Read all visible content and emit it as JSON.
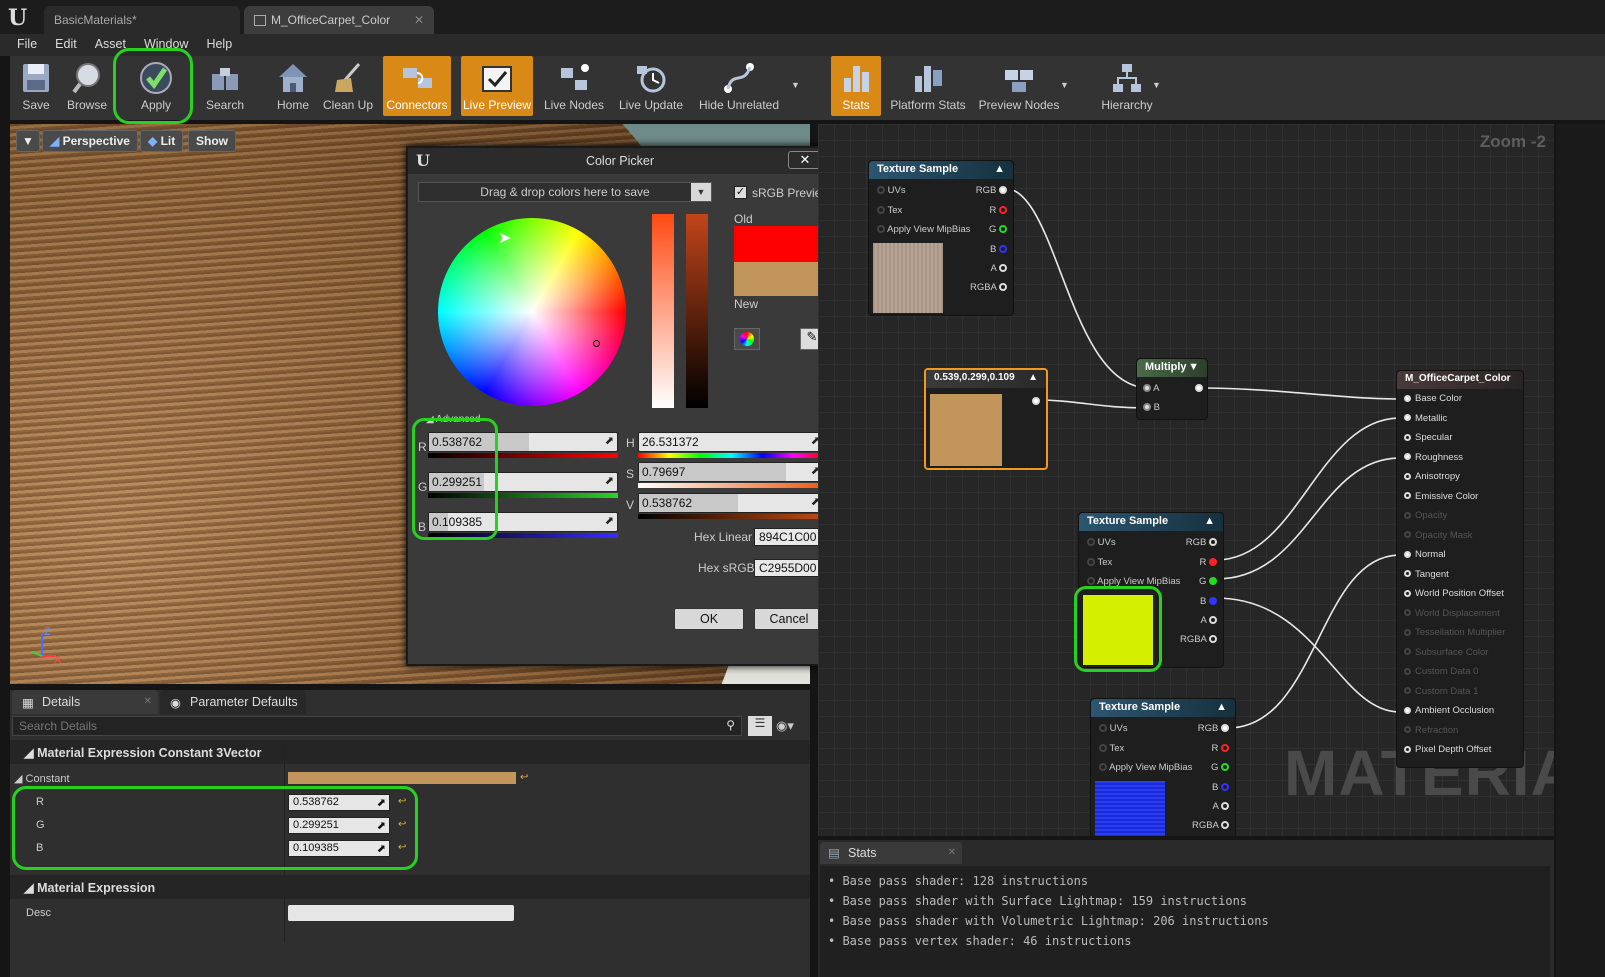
{
  "window": {
    "tabs": [
      {
        "label": "BasicMaterials*"
      },
      {
        "label": "M_OfficeCarpet_Color",
        "close": "✕"
      }
    ]
  },
  "menu": [
    "File",
    "Edit",
    "Asset",
    "Window",
    "Help"
  ],
  "toolbar": {
    "buttons": [
      {
        "label": "Save",
        "icon": "save-icon"
      },
      {
        "label": "Browse",
        "icon": "browse-icon"
      },
      {
        "label": "Apply",
        "icon": "apply-check-icon",
        "highlighted": true
      },
      {
        "label": "Search",
        "icon": "search-icon"
      },
      {
        "label": "Home",
        "icon": "home-icon"
      },
      {
        "label": "Clean Up",
        "icon": "broom-icon"
      },
      {
        "label": "Connectors",
        "icon": "connectors-icon",
        "active": true
      },
      {
        "label": "Live Preview",
        "icon": "live-preview-icon",
        "active": true
      },
      {
        "label": "Live Nodes",
        "icon": "live-nodes-icon"
      },
      {
        "label": "Live Update",
        "icon": "live-update-icon"
      },
      {
        "label": "Hide Unrelated",
        "icon": "hide-unrelated-icon"
      },
      {
        "label": "Stats",
        "icon": "stats-icon",
        "active": true
      },
      {
        "label": "Platform Stats",
        "icon": "platform-stats-icon"
      },
      {
        "label": "Preview Nodes",
        "icon": "preview-nodes-icon"
      },
      {
        "label": "Hierarchy",
        "icon": "hierarchy-icon"
      }
    ]
  },
  "viewport": {
    "perspective": "Perspective",
    "lit": "Lit",
    "show": "Show",
    "axis_z": "Z",
    "axis_x": "X"
  },
  "color_picker": {
    "title": "Color Picker",
    "close": "✕",
    "drop_area": "Drag & drop colors here to save",
    "srgb_preview": "sRGB Preview",
    "old_label": "Old",
    "new_label": "New",
    "old_color": "#ff0000",
    "new_color": "#c2955d",
    "advanced": "Advanced",
    "r_label": "R",
    "r_value": "0.538762",
    "g_label": "G",
    "g_value": "0.299251",
    "b_label": "B",
    "b_value": "0.109385",
    "h_label": "H",
    "h_value": "26.531372",
    "s_label": "S",
    "s_value": "0.79697",
    "v_label": "V",
    "v_value": "0.538762",
    "hex_linear_label": "Hex Linear",
    "hex_linear": "894C1C00",
    "hex_srgb_label": "Hex sRGB",
    "hex_srgb": "C2955D00",
    "ok": "OK",
    "cancel": "Cancel"
  },
  "graph": {
    "zoom": "Zoom -2",
    "watermark": "MATERIAL",
    "tex1": {
      "title": "Texture Sample",
      "pins_in": [
        "UVs",
        "Tex",
        "Apply View MipBias"
      ],
      "pins_out": [
        "RGB",
        "R",
        "G",
        "B",
        "A",
        "RGBA"
      ]
    },
    "constant": {
      "title": "0.539,0.299,0.109",
      "color": "#c2955d"
    },
    "multiply": {
      "title": "Multiply",
      "a": "A",
      "b": "B"
    },
    "tex2": {
      "title": "Texture Sample",
      "pins_in": [
        "UVs",
        "Tex",
        "Apply View MipBias"
      ],
      "pins_out": [
        "RGB",
        "R",
        "G",
        "B",
        "A",
        "RGBA"
      ],
      "swatch": "#d4f000"
    },
    "tex3": {
      "title": "Texture Sample",
      "pins_in": [
        "UVs",
        "Tex",
        "Apply View MipBias"
      ],
      "pins_out": [
        "RGB",
        "R",
        "G",
        "B",
        "A",
        "RGBA"
      ]
    },
    "result": {
      "title": "M_OfficeCarpet_Color",
      "pins": [
        {
          "label": "Base Color",
          "on": true
        },
        {
          "label": "Metallic",
          "on": true
        },
        {
          "label": "Specular",
          "on": true
        },
        {
          "label": "Roughness",
          "on": true
        },
        {
          "label": "Anisotropy",
          "on": true
        },
        {
          "label": "Emissive Color",
          "on": true
        },
        {
          "label": "Opacity",
          "on": false
        },
        {
          "label": "Opacity Mask",
          "on": false
        },
        {
          "label": "Normal",
          "on": true
        },
        {
          "label": "Tangent",
          "on": true
        },
        {
          "label": "World Position Offset",
          "on": true
        },
        {
          "label": "World Displacement",
          "on": false
        },
        {
          "label": "Tessellation Multiplier",
          "on": false
        },
        {
          "label": "Subsurface Color",
          "on": false
        },
        {
          "label": "Custom Data 0",
          "on": false
        },
        {
          "label": "Custom Data 1",
          "on": false
        },
        {
          "label": "Ambient Occlusion",
          "on": true
        },
        {
          "label": "Refraction",
          "on": false
        },
        {
          "label": "Pixel Depth Offset",
          "on": true
        }
      ]
    }
  },
  "details": {
    "tab_details": "Details",
    "tab_params": "Parameter Defaults",
    "search_placeholder": "Search Details",
    "section1": "Material Expression Constant 3Vector",
    "constant_label": "Constant",
    "constant_color": "#c2955d",
    "r_label": "R",
    "r": "0.538762",
    "g_label": "G",
    "g": "0.299251",
    "b_label": "B",
    "b": "0.109385",
    "section2": "Material Expression",
    "desc_label": "Desc"
  },
  "stats": {
    "tab": "Stats",
    "lines": [
      "Base pass shader: 128 instructions",
      "Base pass shader with Surface Lightmap: 159 instructions",
      "Base pass shader with Volumetric Lightmap: 206 instructions",
      "Base pass vertex shader: 46 instructions"
    ]
  }
}
